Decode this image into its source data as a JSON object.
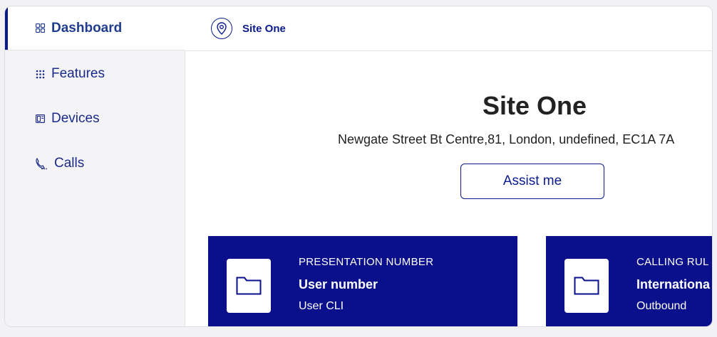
{
  "sidebar": {
    "items": [
      {
        "label": "Dashboard",
        "icon": "dashboard-icon",
        "active": true
      },
      {
        "label": "Features",
        "icon": "grid-icon",
        "active": false
      },
      {
        "label": "Devices",
        "icon": "device-icon",
        "active": false
      },
      {
        "label": "Calls",
        "icon": "phone-icon",
        "active": false
      }
    ]
  },
  "header": {
    "site_name": "Site One",
    "icon": "location-pin-icon"
  },
  "main": {
    "title": "Site One",
    "address": "Newgate Street Bt Centre,81, London, undefined, EC1A 7A",
    "assist_label": "Assist me",
    "cards": [
      {
        "label": "PRESENTATION NUMBER",
        "value": "User number",
        "sub": "User CLI",
        "icon": "folder-icon"
      },
      {
        "label": "CALLING RUL",
        "value": "Internationa",
        "sub": "Outbound",
        "icon": "folder-icon"
      }
    ]
  },
  "colors": {
    "brand": "#0a0f8c",
    "sidebar_bg": "#f4f4f6",
    "active_text": "#1f3c8f"
  }
}
